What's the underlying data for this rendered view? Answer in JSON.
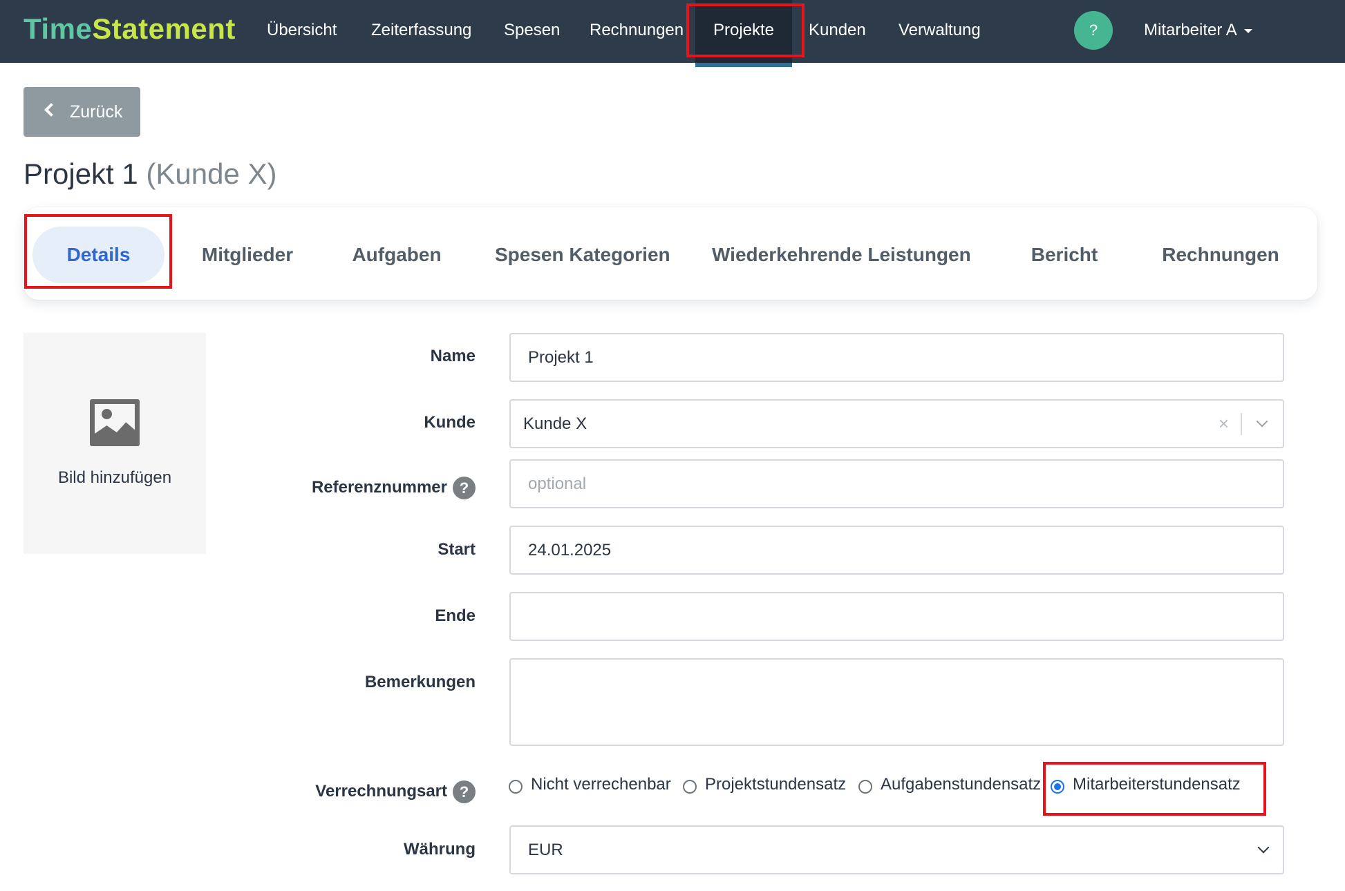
{
  "brand": {
    "part1": "Time",
    "part2": "Statement"
  },
  "nav": {
    "items": [
      "Übersicht",
      "Zeiterfassung",
      "Spesen",
      "Rechnungen",
      "Projekte",
      "Kunden",
      "Verwaltung"
    ],
    "help": "?",
    "user": "Mitarbeiter A"
  },
  "back_label": "Zurück",
  "title": {
    "project": "Projekt 1",
    "customer": "(Kunde X)"
  },
  "tabs": [
    "Details",
    "Mitglieder",
    "Aufgaben",
    "Spesen Kategorien",
    "Wiederkehrende Leistungen",
    "Bericht",
    "Rechnungen"
  ],
  "image": {
    "caption": "Bild hinzufügen"
  },
  "form": {
    "name": {
      "label": "Name",
      "value": "Projekt 1"
    },
    "kunde": {
      "label": "Kunde",
      "value": "Kunde X",
      "clear": "×"
    },
    "referenz": {
      "label": "Referenznummer",
      "placeholder": "optional",
      "help": "?"
    },
    "start": {
      "label": "Start",
      "value": "24.01.2025"
    },
    "ende": {
      "label": "Ende",
      "value": ""
    },
    "bemerkungen": {
      "label": "Bemerkungen",
      "value": ""
    },
    "verrechnungsart": {
      "label": "Verrechnungsart",
      "help": "?",
      "options": [
        "Nicht verrechenbar",
        "Projektstundensatz",
        "Aufgabenstundensatz",
        "Mitarbeiterstundensatz"
      ],
      "selected": "Mitarbeiterstundensatz"
    },
    "waehrung": {
      "label": "Währung",
      "value": "EUR"
    }
  },
  "colors": {
    "highlight": "#e8141c",
    "accent": "#2f66d0",
    "navbar": "#2e3b4b"
  }
}
